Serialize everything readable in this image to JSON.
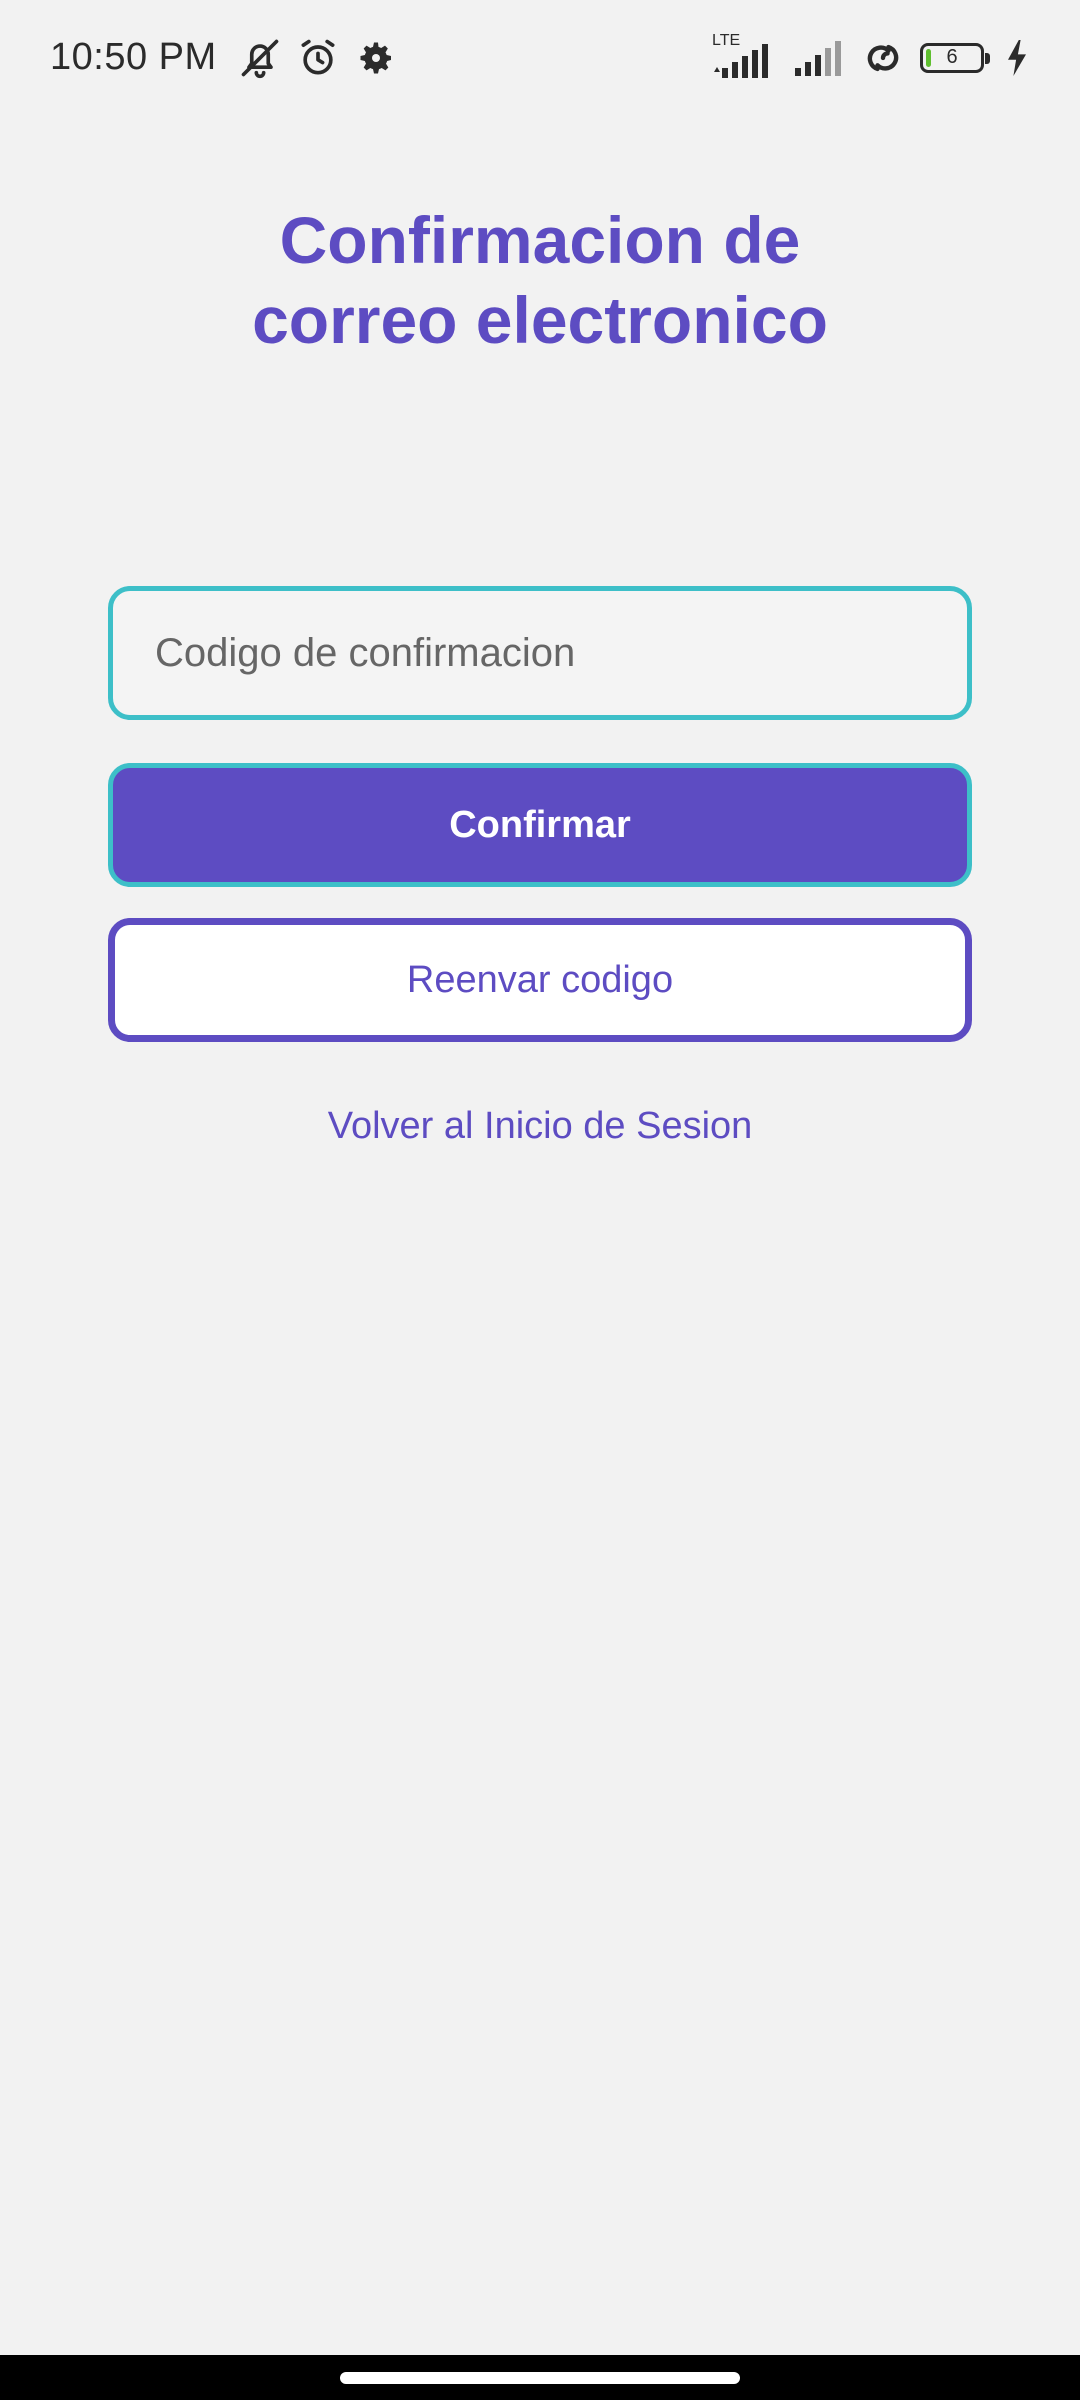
{
  "status_bar": {
    "time": "10:50 PM",
    "network_label": "LTE",
    "battery_level": "6",
    "icons": [
      "mute-icon",
      "alarm-icon",
      "settings-gear-icon",
      "lte-signal-icon",
      "signal-icon",
      "hotspot-link-icon",
      "battery-icon",
      "charging-bolt-icon"
    ]
  },
  "page": {
    "title_line1": "Confirmacion de",
    "title_line2": "correo electronico"
  },
  "form": {
    "code_placeholder": "Codigo de confirmacion",
    "code_value": "",
    "confirm_label": "Confirmar",
    "resend_label": "Reenvar codigo",
    "back_label": "Volver al Inicio de Sesion"
  },
  "colors": {
    "primary": "#5d4cc2",
    "accent_border": "#3dbfc8",
    "background": "#f2f2f2"
  }
}
